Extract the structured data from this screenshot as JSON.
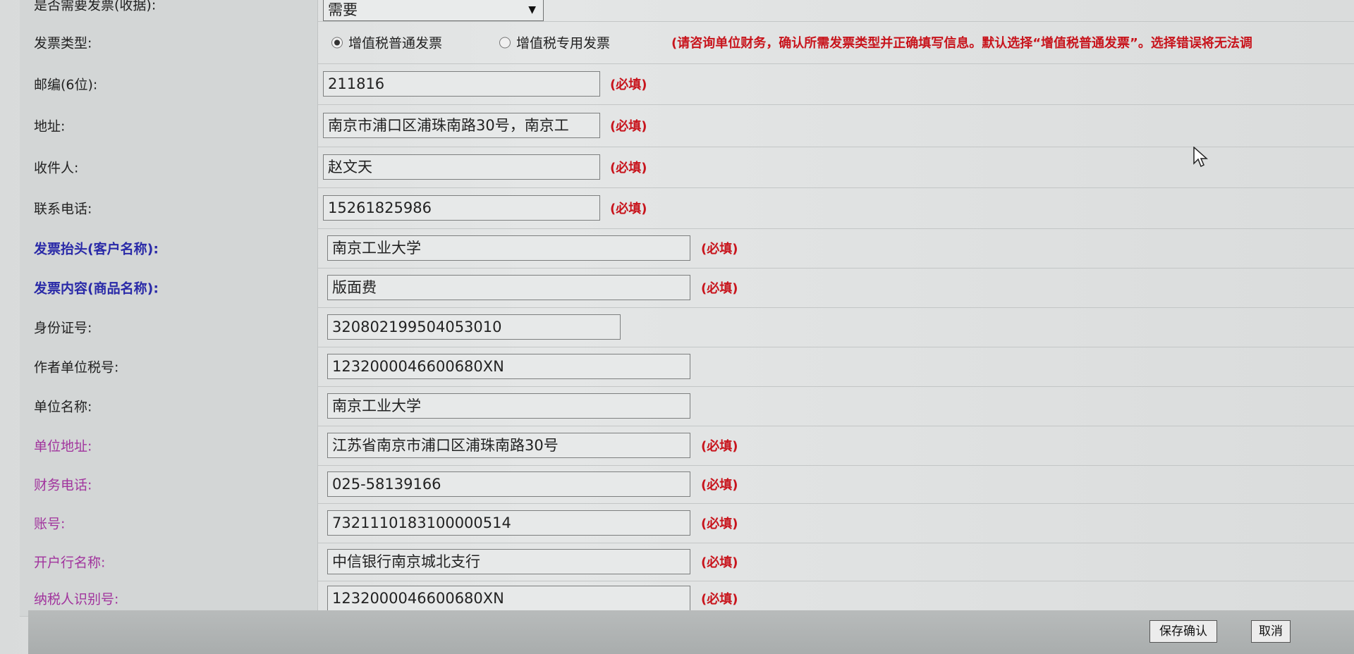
{
  "rows": [
    {
      "label": "是否需要发票(收据):",
      "value": "需要"
    },
    {
      "label": "发票类型:",
      "options": [
        "增值税普通发票",
        "增值税专用发票"
      ],
      "selected": 0,
      "notice": "(请咨询单位财务，确认所需发票类型并正确填写信息。默认选择“增值税普通发票”。选择错误将无法调"
    },
    {
      "label": "邮编(6位):",
      "value": "211816",
      "required": "(必填)"
    },
    {
      "label": "地址:",
      "value": "南京市浦口区浦珠南路30号，南京工",
      "required": "(必填)"
    },
    {
      "label": "收件人:",
      "value": "赵文天",
      "required": "(必填)"
    },
    {
      "label": "联系电话:",
      "value": "15261825986",
      "required": "(必填)"
    },
    {
      "label": "发票抬头(客户名称):",
      "value": "南京工业大学",
      "required": "(必填)"
    },
    {
      "label": "发票内容(商品名称):",
      "value": "版面费",
      "required": "(必填)"
    },
    {
      "label": "身份证号:",
      "value": "320802199504053010"
    },
    {
      "label": "作者单位税号:",
      "value": "1232000046600680XN"
    },
    {
      "label": "单位名称:",
      "value": "南京工业大学"
    },
    {
      "label": "单位地址:",
      "value": "江苏省南京市浦口区浦珠南路30号",
      "required": "(必填)"
    },
    {
      "label": "财务电话:",
      "value": "025-58139166",
      "required": "(必填)"
    },
    {
      "label": "账号:",
      "value": "7321110183100000514",
      "required": "(必填)"
    },
    {
      "label": "开户行名称:",
      "value": "中信银行南京城北支行",
      "required": "(必填)"
    },
    {
      "label": "纳税人识别号:",
      "value": "1232000046600680XN",
      "required": "(必填)"
    }
  ],
  "footer": {
    "save_label": "保存确认",
    "cancel_label": "取消"
  },
  "colors": {
    "required": "#c8141c",
    "label_blue": "#2a2aa8",
    "label_purple": "#a1349d"
  },
  "icons": [
    "select-arrow-icon",
    "radio-icon",
    "mouse-cursor-icon"
  ]
}
